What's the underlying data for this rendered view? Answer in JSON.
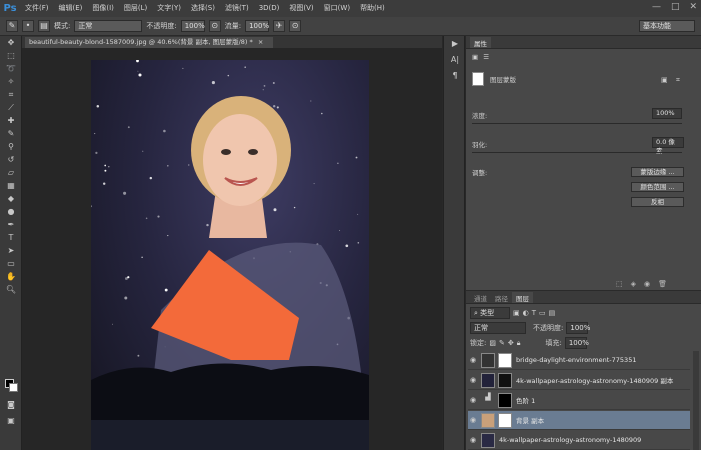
{
  "app": {
    "logo": "Ps"
  },
  "menu": [
    "文件(F)",
    "编辑(E)",
    "图像(I)",
    "图层(L)",
    "文字(Y)",
    "选择(S)",
    "滤镜(T)",
    "3D(D)",
    "视图(V)",
    "窗口(W)",
    "帮助(H)"
  ],
  "window_controls": [
    "—",
    "□",
    "✕"
  ],
  "options": {
    "mode_label": "模式:",
    "mode_value": "正常",
    "opacity_label": "不透明度:",
    "opacity_value": "100%",
    "flow_label": "流量:",
    "flow_value": "100%",
    "workspace": "基本功能"
  },
  "document": {
    "tab_title": "beautiful-beauty-blond-1587009.jpg @ 40.6%(背景 副本, 图层蒙版/8) *",
    "close": "×"
  },
  "properties": {
    "tabs": [
      "属性"
    ],
    "mask_label": "图层蒙版",
    "density_label": "浓度:",
    "density_value": "100%",
    "feather_label": "羽化:",
    "feather_value": "0.0 像素",
    "adjust_label": "调整:",
    "buttons": [
      "蒙版边缘 ...",
      "颜色范围 ...",
      "反相"
    ]
  },
  "layers_panel": {
    "tabs": [
      "图层",
      "通道",
      "路径"
    ],
    "kind_label": "类型",
    "blend_mode": "正常",
    "opacity_label": "不透明度:",
    "opacity_value": "100%",
    "lock_label": "锁定:",
    "fill_label": "填充:",
    "fill_value": "100%",
    "layers": [
      {
        "name": "bridge-daylight-environment-775351",
        "selected": false
      },
      {
        "name": "4k-wallpaper-astrology-astronomy-1480909 副本",
        "selected": false
      },
      {
        "name": "色阶 1",
        "selected": false
      },
      {
        "name": "背景 副本",
        "selected": true
      },
      {
        "name": "4k-wallpaper-astrology-astronomy-1480909",
        "selected": false
      }
    ]
  },
  "colors": {
    "accent": "#3b8fd9",
    "selection": "#6a7c92",
    "tablet": "#f36a3a"
  }
}
